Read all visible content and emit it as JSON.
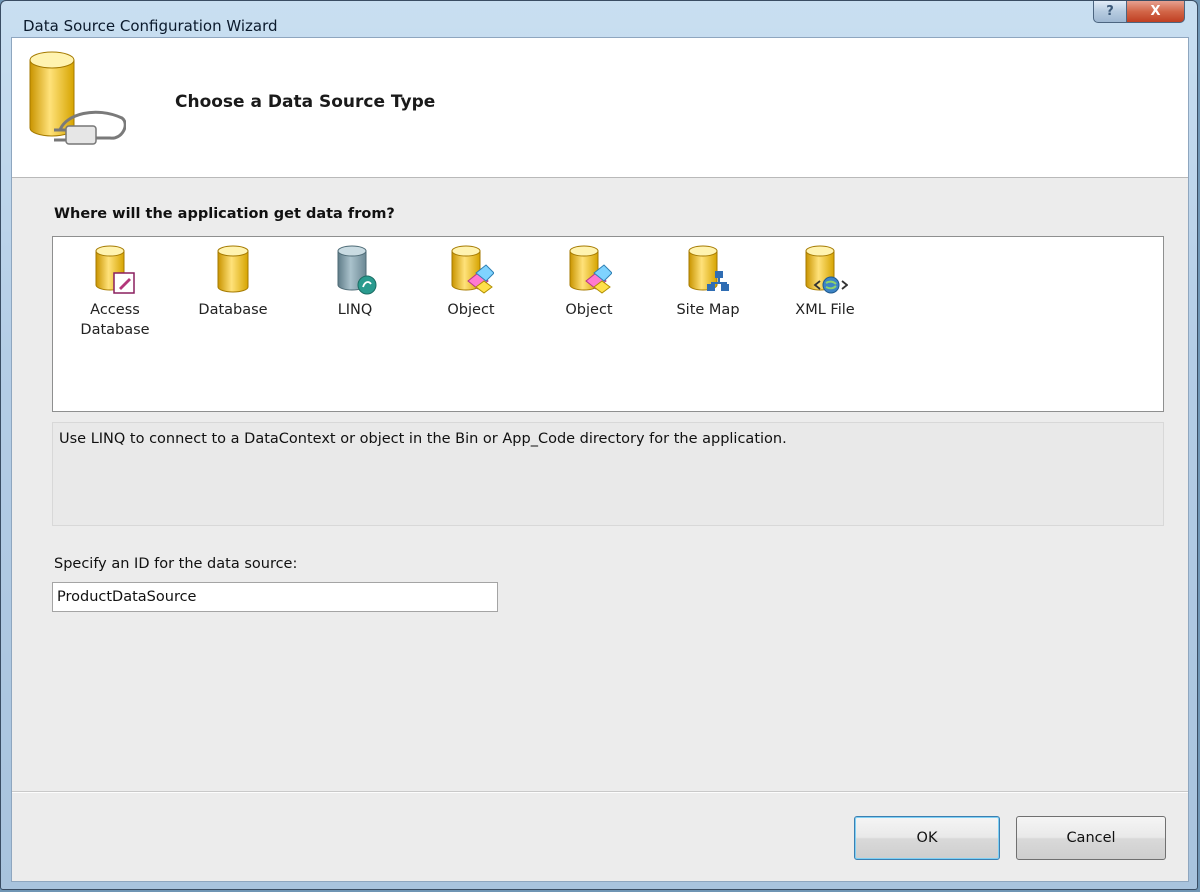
{
  "window": {
    "title": "Data Source Configuration Wizard",
    "help_glyph": "?",
    "close_glyph": "X"
  },
  "header": {
    "title": "Choose a Data Source Type"
  },
  "source_group": {
    "label": "Where will the application get data from?",
    "items": [
      {
        "label": "Access Database",
        "icon": "access-database-icon",
        "selected": false
      },
      {
        "label": "Database",
        "icon": "database-icon",
        "selected": false
      },
      {
        "label": "LINQ",
        "icon": "linq-icon",
        "selected": true
      },
      {
        "label": "Object",
        "icon": "object-icon",
        "selected": false
      },
      {
        "label": "Object",
        "icon": "object-icon",
        "selected": false
      },
      {
        "label": "Site Map",
        "icon": "site-map-icon",
        "selected": false
      },
      {
        "label": "XML File",
        "icon": "xml-file-icon",
        "selected": false
      }
    ]
  },
  "description": "Use LINQ to connect to a DataContext or object in the Bin or App_Code directory for the application.",
  "id_field": {
    "label": "Specify an ID for the data source:",
    "value": "ProductDataSource"
  },
  "buttons": {
    "ok": "OK",
    "cancel": "Cancel"
  },
  "colors": {
    "selection": "#3399ff",
    "cylinder_gold": "#e8b400",
    "cylinder_linq": "#7f9ca8"
  }
}
